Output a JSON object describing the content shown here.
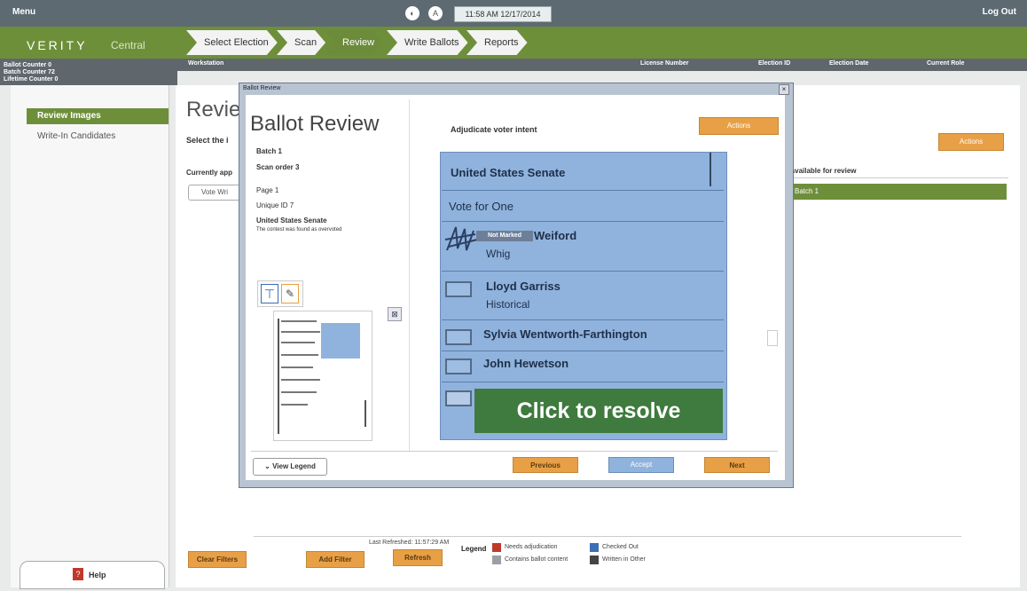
{
  "topbar": {
    "menu": "Menu",
    "logout": "Log Out",
    "time": "11:58 AM 12/17/2014"
  },
  "nav": {
    "brand": "VERITY",
    "module": "Central",
    "steps": [
      "Select Election",
      "Scan",
      "Review",
      "Write Ballots",
      "Reports"
    ]
  },
  "info": {
    "left": [
      "Ballot Counter 0",
      "Batch Counter 72",
      "Lifetime Counter 0"
    ],
    "workstation": "Workstation",
    "items": [
      "License Number",
      "Election ID",
      "Election Date",
      "Current Role"
    ]
  },
  "sidebar": {
    "items": [
      "Review Images",
      "Write-In Candidates"
    ],
    "help": "Help"
  },
  "main": {
    "title": "Revie",
    "select": "Select the i",
    "currently": "Currently app",
    "vote_button": "Vote Wri",
    "available": "s available for review",
    "available_bar": "Batch 1",
    "actions": "Actions"
  },
  "bottom": {
    "clear_filters": "Clear Filters",
    "add_filter": "Add Filter",
    "refresh": "Refresh",
    "last_refreshed": "Last Refreshed: 11:57:29 AM",
    "legend_label": "Legend",
    "legend": [
      {
        "text": "Needs adjudication",
        "color": "#c0392b"
      },
      {
        "text": "Checked Out",
        "color": "#3b6fb6"
      },
      {
        "text": "Contains ballot content",
        "color": "#9aa0a6"
      },
      {
        "text": "Written in Other",
        "color": "#444444"
      }
    ]
  },
  "modal": {
    "window_title": "Ballot Review",
    "title": "Ballot Review",
    "adjudicate": "Adjudicate voter intent",
    "actions": "Actions",
    "info": [
      "Batch 1",
      "Scan order 3",
      "Page 1",
      "Unique ID 7",
      "United States Senate",
      "The contest was found as overvoted"
    ],
    "view_legend": "View Legend",
    "previous": "Previous",
    "accept": "Accept",
    "next": "Next",
    "zoom_icon": "zoom-out-icon"
  },
  "ballot": {
    "contest": "United States Senate",
    "instructions": "Vote for One",
    "candidates": [
      {
        "name": "Weiford",
        "party": "Whig"
      },
      {
        "name": "Lloyd Garriss",
        "party": "Historical"
      },
      {
        "name": "Sylvia Wentworth-Farthington",
        "party": ""
      },
      {
        "name": "John Hewetson",
        "party": ""
      }
    ],
    "not_marked": "Not Marked",
    "resolve": "Click to resolve"
  },
  "colors": {
    "green": "#6e8f3a",
    "orange": "#e8a046",
    "ballot_blue": "#8fb3dd",
    "resolve_green": "#3f7a3e"
  }
}
